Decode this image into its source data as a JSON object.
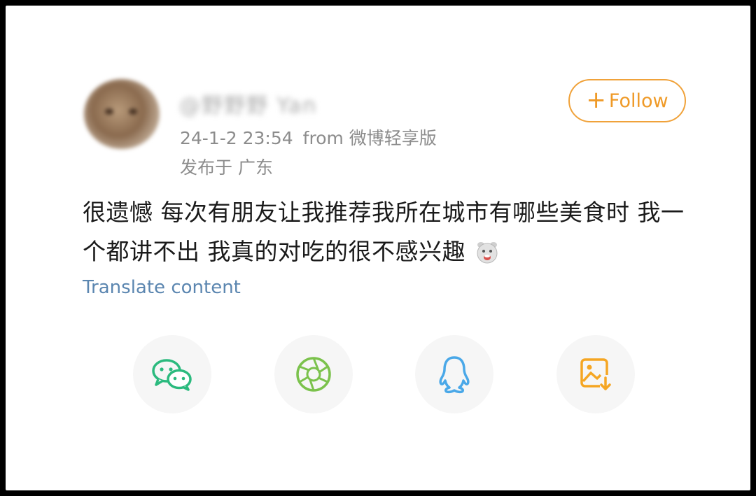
{
  "post": {
    "username": "@野野野 Yan",
    "timestamp": "24-1-2 23:54",
    "source": "from 微博轻享版",
    "location": "发布于 广东",
    "text": "很遗憾 每次有朋友让我推荐我所在城市有哪些美食时 我一个都讲不出 我真的对吃的很不感兴趣",
    "emoji": "sheep-face-emoji",
    "translate_label": "Translate content"
  },
  "follow": {
    "label": "Follow"
  },
  "share_buttons": [
    {
      "icon": "wechat-icon",
      "color": "#2bba7e"
    },
    {
      "icon": "moments-icon",
      "color": "#7bc24c"
    },
    {
      "icon": "qq-icon",
      "color": "#4aa8e8"
    },
    {
      "icon": "save-image-icon",
      "color": "#f5a623"
    }
  ]
}
